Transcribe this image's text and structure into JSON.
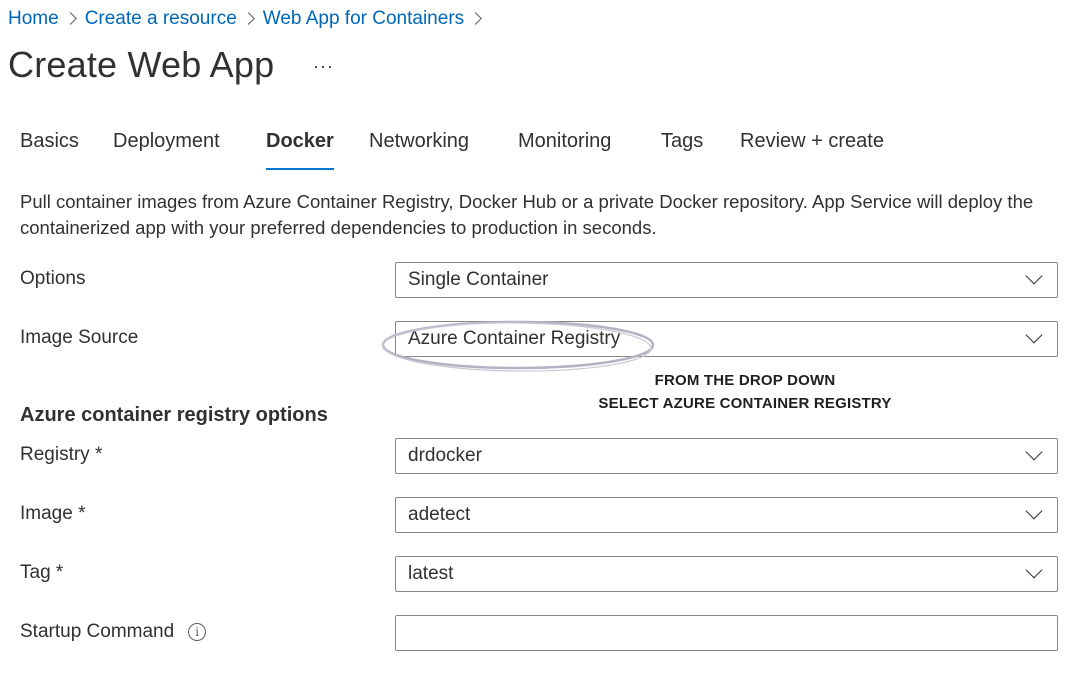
{
  "breadcrumb": {
    "items": [
      "Home",
      "Create a resource",
      "Web App for Containers"
    ]
  },
  "header": {
    "title": "Create Web App",
    "more_label": "···"
  },
  "tabs": [
    {
      "label": "Basics",
      "active": false
    },
    {
      "label": "Deployment",
      "active": false
    },
    {
      "label": "Docker",
      "active": true
    },
    {
      "label": "Networking",
      "active": false
    },
    {
      "label": "Monitoring",
      "active": false
    },
    {
      "label": "Tags",
      "active": false
    },
    {
      "label": "Review + create",
      "active": false
    }
  ],
  "description": "Pull container images from Azure Container Registry, Docker Hub or a private Docker repository. App Service will deploy the containerized app with your preferred dependencies to production in seconds.",
  "form": {
    "options": {
      "label": "Options",
      "value": "Single Container"
    },
    "image_source": {
      "label": "Image Source",
      "value": "Azure Container Registry"
    },
    "section_heading": "Azure container registry options",
    "registry": {
      "label": "Registry *",
      "value": "drdocker"
    },
    "image": {
      "label": "Image *",
      "value": "adetect"
    },
    "tag": {
      "label": "Tag *",
      "value": "latest"
    },
    "startup_command": {
      "label": "Startup Command",
      "value": "",
      "info_icon": "info-icon"
    }
  },
  "annotation": {
    "line1": "FROM THE DROP DOWN",
    "line2": "SELECT AZURE CONTAINER REGISTRY"
  },
  "colors": {
    "link": "#0067b8",
    "accent": "#0078d4",
    "text": "#323130",
    "border": "#8a8886"
  }
}
